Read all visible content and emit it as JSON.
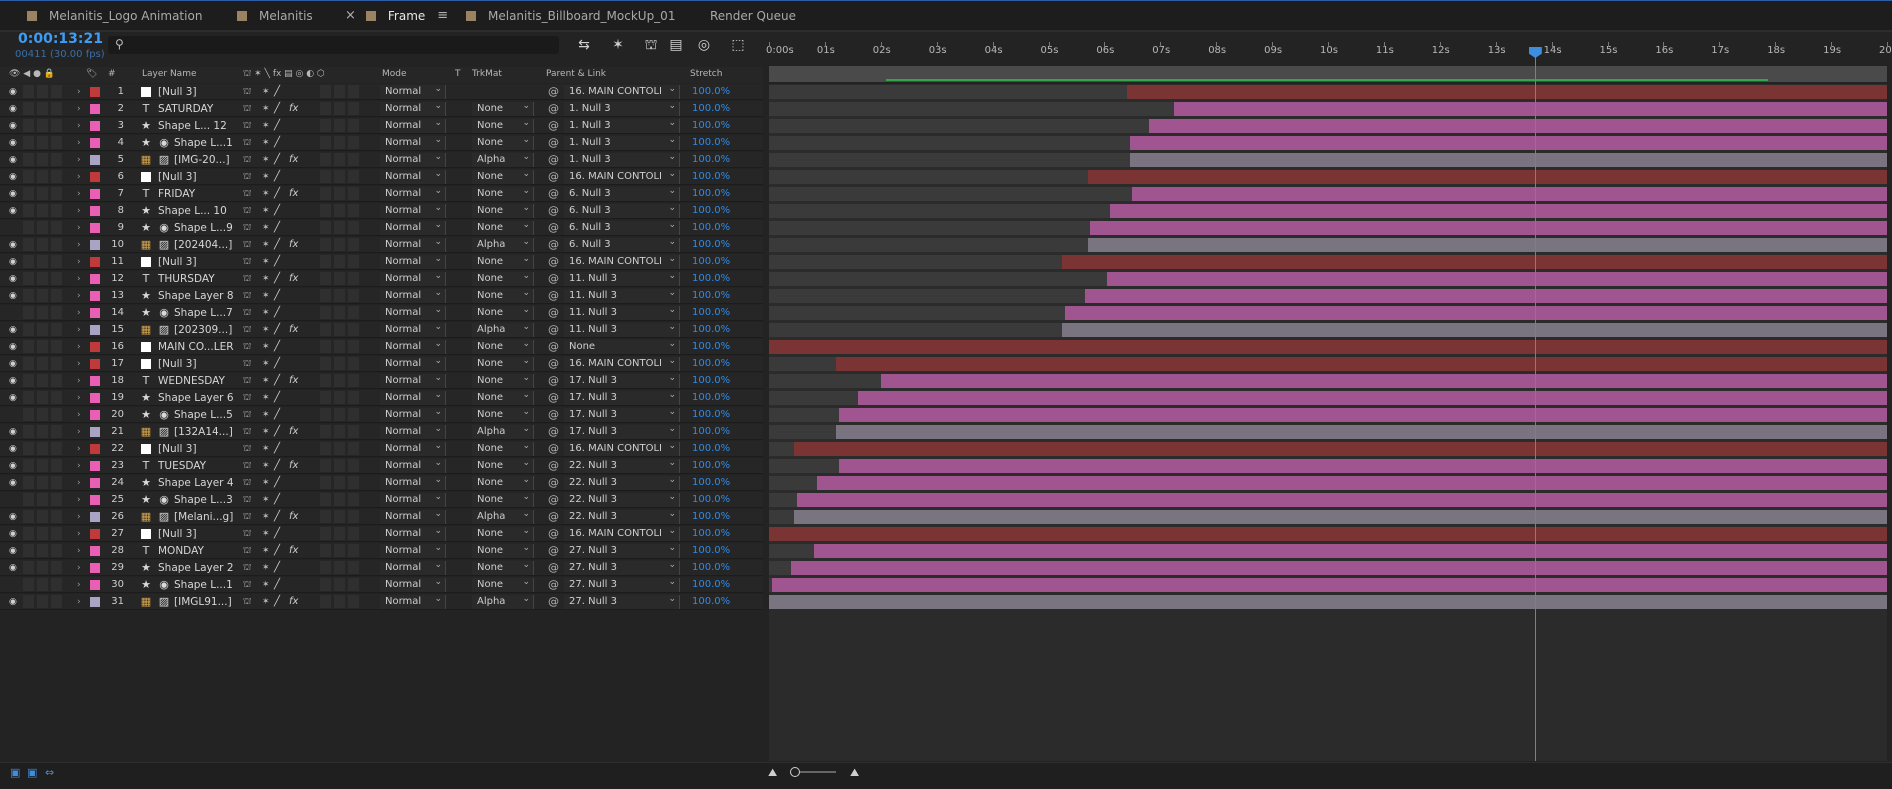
{
  "tabs": [
    {
      "label": "Melanitis_Logo Animation",
      "active": false,
      "swatch": true
    },
    {
      "label": "Melanitis",
      "active": false,
      "swatch": true
    },
    {
      "label": "Frame",
      "active": true,
      "swatch": true
    },
    {
      "label": "Melanitis_Billboard_MockUp_01",
      "active": false,
      "swatch": true
    },
    {
      "label": "Render Queue",
      "active": false,
      "swatch": false
    }
  ],
  "toolbar": {
    "timecode": "0:00:13:21",
    "frames": "00411 (30.00 fps)",
    "search_placeholder": ""
  },
  "columns": {
    "layer_name": "Layer Name",
    "mode": "Mode",
    "t": "T",
    "trkmat": "TrkMat",
    "parent": "Parent & Link",
    "stretch": "Stretch",
    "hash": "#"
  },
  "ruler": {
    "ticks": [
      "0:00s",
      "01s",
      "02s",
      "03s",
      "04s",
      "05s",
      "06s",
      "07s",
      "08s",
      "09s",
      "10s",
      "11s",
      "12s",
      "13s",
      "14s",
      "15s",
      "16s",
      "17s",
      "18s",
      "19s",
      "20s"
    ]
  },
  "colors": {
    "accent": "#3e8ee0",
    "null_label": "#c0393b",
    "shape_label": "#e85fb4",
    "footage_label": "#a9a4c4",
    "bar_null": "#7a3434",
    "bar_shape": "#a05590",
    "bar_footage": "#7a7380"
  },
  "layers": [
    {
      "num": "1",
      "type": "null",
      "name": "[Null 3]",
      "mode": "Normal",
      "trkmat": "",
      "parent": "16. MAIN CONTOLI",
      "stretch": "100.0%",
      "fx": false,
      "eye": true
    },
    {
      "num": "2",
      "type": "text",
      "name": "SATURDAY",
      "mode": "Normal",
      "trkmat": "None",
      "parent": "1. Null 3",
      "stretch": "100.0%",
      "fx": true,
      "eye": true
    },
    {
      "num": "3",
      "type": "shape",
      "name": "Shape L... 12",
      "mode": "Normal",
      "trkmat": "None",
      "parent": "1. Null 3",
      "stretch": "100.0%",
      "fx": false,
      "eye": true
    },
    {
      "num": "4",
      "type": "shape2",
      "name": "Shape L...1",
      "mode": "Normal",
      "trkmat": "None",
      "parent": "1. Null 3",
      "stretch": "100.0%",
      "fx": false,
      "eye": true
    },
    {
      "num": "5",
      "type": "footage",
      "name": "[IMG-20...]",
      "mode": "Normal",
      "trkmat": "Alpha",
      "parent": "1. Null 3",
      "stretch": "100.0%",
      "fx": true,
      "eye": true
    },
    {
      "num": "6",
      "type": "null",
      "name": "[Null 3]",
      "mode": "Normal",
      "trkmat": "None",
      "parent": "16. MAIN CONTOLI",
      "stretch": "100.0%",
      "fx": false,
      "eye": true
    },
    {
      "num": "7",
      "type": "text",
      "name": "FRIDAY",
      "mode": "Normal",
      "trkmat": "None",
      "parent": "6. Null 3",
      "stretch": "100.0%",
      "fx": true,
      "eye": true
    },
    {
      "num": "8",
      "type": "shape",
      "name": "Shape L... 10",
      "mode": "Normal",
      "trkmat": "None",
      "parent": "6. Null 3",
      "stretch": "100.0%",
      "fx": false,
      "eye": true
    },
    {
      "num": "9",
      "type": "shape2",
      "name": "Shape L...9",
      "mode": "Normal",
      "trkmat": "None",
      "parent": "6. Null 3",
      "stretch": "100.0%",
      "fx": false,
      "eye": false
    },
    {
      "num": "10",
      "type": "footage",
      "name": "[202404...]",
      "mode": "Normal",
      "trkmat": "Alpha",
      "parent": "6. Null 3",
      "stretch": "100.0%",
      "fx": true,
      "eye": true
    },
    {
      "num": "11",
      "type": "null",
      "name": "[Null 3]",
      "mode": "Normal",
      "trkmat": "None",
      "parent": "16. MAIN CONTOLI",
      "stretch": "100.0%",
      "fx": false,
      "eye": true
    },
    {
      "num": "12",
      "type": "text",
      "name": "THURSDAY",
      "mode": "Normal",
      "trkmat": "None",
      "parent": "11. Null 3",
      "stretch": "100.0%",
      "fx": true,
      "eye": true
    },
    {
      "num": "13",
      "type": "shape",
      "name": "Shape Layer 8",
      "mode": "Normal",
      "trkmat": "None",
      "parent": "11. Null 3",
      "stretch": "100.0%",
      "fx": false,
      "eye": true
    },
    {
      "num": "14",
      "type": "shape2",
      "name": "Shape L...7",
      "mode": "Normal",
      "trkmat": "None",
      "parent": "11. Null 3",
      "stretch": "100.0%",
      "fx": false,
      "eye": false
    },
    {
      "num": "15",
      "type": "footage",
      "name": "[202309...]",
      "mode": "Normal",
      "trkmat": "Alpha",
      "parent": "11. Null 3",
      "stretch": "100.0%",
      "fx": true,
      "eye": true
    },
    {
      "num": "16",
      "type": "null",
      "name": "MAIN CO...LER",
      "mode": "Normal",
      "trkmat": "None",
      "parent": "None",
      "stretch": "100.0%",
      "fx": false,
      "eye": true
    },
    {
      "num": "17",
      "type": "null",
      "name": "[Null 3]",
      "mode": "Normal",
      "trkmat": "None",
      "parent": "16. MAIN CONTOLI",
      "stretch": "100.0%",
      "fx": false,
      "eye": true
    },
    {
      "num": "18",
      "type": "text",
      "name": "WEDNESDAY",
      "mode": "Normal",
      "trkmat": "None",
      "parent": "17. Null 3",
      "stretch": "100.0%",
      "fx": true,
      "eye": true
    },
    {
      "num": "19",
      "type": "shape",
      "name": "Shape Layer 6",
      "mode": "Normal",
      "trkmat": "None",
      "parent": "17. Null 3",
      "stretch": "100.0%",
      "fx": false,
      "eye": true
    },
    {
      "num": "20",
      "type": "shape2",
      "name": "Shape L...5",
      "mode": "Normal",
      "trkmat": "None",
      "parent": "17. Null 3",
      "stretch": "100.0%",
      "fx": false,
      "eye": false
    },
    {
      "num": "21",
      "type": "footage",
      "name": "[132A14...]",
      "mode": "Normal",
      "trkmat": "Alpha",
      "parent": "17. Null 3",
      "stretch": "100.0%",
      "fx": true,
      "eye": true
    },
    {
      "num": "22",
      "type": "null",
      "name": "[Null 3]",
      "mode": "Normal",
      "trkmat": "None",
      "parent": "16. MAIN CONTOLI",
      "stretch": "100.0%",
      "fx": false,
      "eye": true
    },
    {
      "num": "23",
      "type": "text",
      "name": "TUESDAY",
      "mode": "Normal",
      "trkmat": "None",
      "parent": "22. Null 3",
      "stretch": "100.0%",
      "fx": true,
      "eye": true
    },
    {
      "num": "24",
      "type": "shape",
      "name": "Shape Layer 4",
      "mode": "Normal",
      "trkmat": "None",
      "parent": "22. Null 3",
      "stretch": "100.0%",
      "fx": false,
      "eye": true
    },
    {
      "num": "25",
      "type": "shape2",
      "name": "Shape L...3",
      "mode": "Normal",
      "trkmat": "None",
      "parent": "22. Null 3",
      "stretch": "100.0%",
      "fx": false,
      "eye": false
    },
    {
      "num": "26",
      "type": "footage",
      "name": "[Melani...g]",
      "mode": "Normal",
      "trkmat": "Alpha",
      "parent": "22. Null 3",
      "stretch": "100.0%",
      "fx": true,
      "eye": true
    },
    {
      "num": "27",
      "type": "null",
      "name": "[Null 3]",
      "mode": "Normal",
      "trkmat": "None",
      "parent": "16. MAIN CONTOLI",
      "stretch": "100.0%",
      "fx": false,
      "eye": true
    },
    {
      "num": "28",
      "type": "text",
      "name": "MONDAY",
      "mode": "Normal",
      "trkmat": "None",
      "parent": "27. Null 3",
      "stretch": "100.0%",
      "fx": true,
      "eye": true
    },
    {
      "num": "29",
      "type": "shape",
      "name": "Shape Layer 2",
      "mode": "Normal",
      "trkmat": "None",
      "parent": "27. Null 3",
      "stretch": "100.0%",
      "fx": false,
      "eye": true
    },
    {
      "num": "30",
      "type": "shape2",
      "name": "Shape L...1",
      "mode": "Normal",
      "trkmat": "None",
      "parent": "27. Null 3",
      "stretch": "100.0%",
      "fx": false,
      "eye": false
    },
    {
      "num": "31",
      "type": "footage",
      "name": "[IMGL91...]",
      "mode": "Normal",
      "trkmat": "Alpha",
      "parent": "27. Null 3",
      "stretch": "100.0%",
      "fx": true,
      "eye": true
    }
  ],
  "tracks": [
    {
      "dark_end_s": 6.4,
      "color": "null"
    },
    {
      "dark_end_s": 7.25,
      "color": "shape"
    },
    {
      "dark_end_s": 6.8,
      "color": "shape"
    },
    {
      "dark_end_s": 6.45,
      "color": "shape"
    },
    {
      "dark_end_s": 6.45,
      "color": "footage"
    },
    {
      "dark_end_s": 5.7,
      "color": "null"
    },
    {
      "dark_end_s": 6.5,
      "color": "shape"
    },
    {
      "dark_end_s": 6.1,
      "color": "shape"
    },
    {
      "dark_end_s": 5.75,
      "color": "shape"
    },
    {
      "dark_end_s": 5.7,
      "color": "footage"
    },
    {
      "dark_end_s": 5.25,
      "color": "null"
    },
    {
      "dark_end_s": 6.05,
      "color": "shape"
    },
    {
      "dark_end_s": 5.65,
      "color": "shape"
    },
    {
      "dark_end_s": 5.3,
      "color": "shape"
    },
    {
      "dark_end_s": 5.25,
      "color": "footage"
    },
    {
      "dark_end_s": 0.0,
      "color": "null"
    },
    {
      "dark_end_s": 1.2,
      "color": "null"
    },
    {
      "dark_end_s": 2.0,
      "color": "shape"
    },
    {
      "dark_end_s": 1.6,
      "color": "shape"
    },
    {
      "dark_end_s": 1.25,
      "color": "shape"
    },
    {
      "dark_end_s": 1.2,
      "color": "footage"
    },
    {
      "dark_end_s": 0.45,
      "color": "null"
    },
    {
      "dark_end_s": 1.25,
      "color": "shape"
    },
    {
      "dark_end_s": 0.85,
      "color": "shape"
    },
    {
      "dark_end_s": 0.5,
      "color": "shape"
    },
    {
      "dark_end_s": 0.45,
      "color": "footage"
    },
    {
      "dark_end_s": 0.0,
      "color": "null"
    },
    {
      "dark_end_s": 0.8,
      "color": "shape"
    },
    {
      "dark_end_s": 0.4,
      "color": "shape"
    },
    {
      "dark_end_s": 0.05,
      "color": "shape"
    },
    {
      "dark_end_s": 0.0,
      "color": "footage"
    }
  ],
  "playhead_s": 13.7
}
